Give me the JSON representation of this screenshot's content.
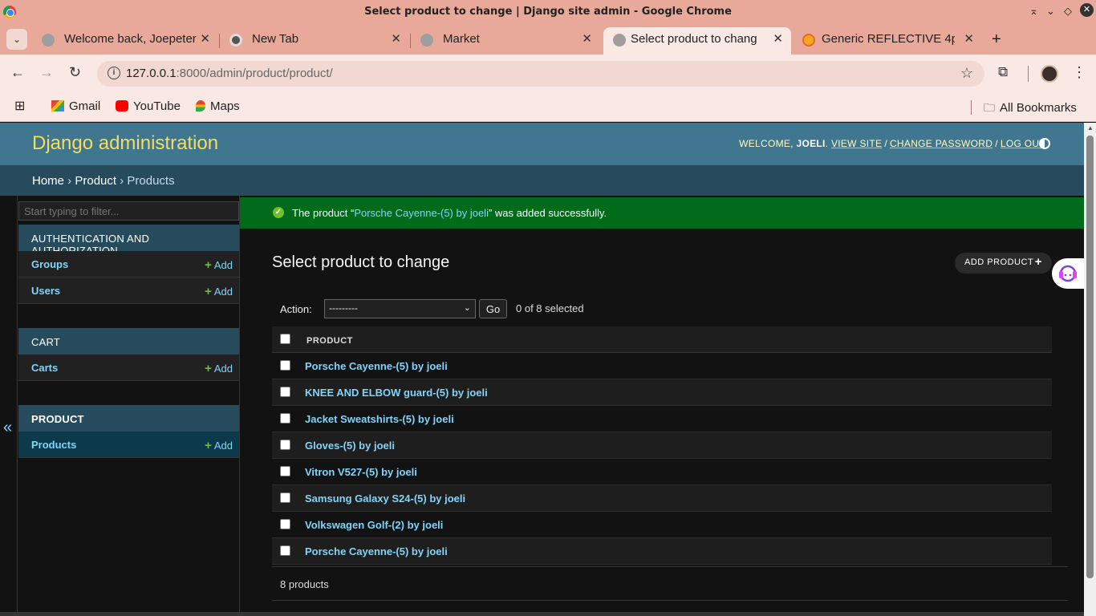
{
  "window": {
    "title": "Select product to change | Django site admin - Google Chrome",
    "controls": [
      "⌅",
      "⌄",
      "◇",
      "✕"
    ]
  },
  "tabs": [
    {
      "label": "Welcome back, Joepeter",
      "favicon": "globe-icon"
    },
    {
      "label": "New Tab",
      "favicon": "chrome-icon"
    },
    {
      "label": "Market",
      "favicon": "globe-icon"
    },
    {
      "label": "Select product to chang",
      "favicon": "globe-icon",
      "active": true
    },
    {
      "label": "Generic REFLECTIVE 4pc",
      "favicon": "aliexpress-icon"
    }
  ],
  "toolbar": {
    "url_host": "127.0.0.1",
    "url_path": ":8000/admin/product/product/"
  },
  "bookmarks": [
    {
      "label": "Gmail",
      "icon": "gmail-icon"
    },
    {
      "label": "YouTube",
      "icon": "youtube-icon"
    },
    {
      "label": "Maps",
      "icon": "maps-icon"
    }
  ],
  "bookmarks_all": "All Bookmarks",
  "django": {
    "site_name": "Django administration",
    "welcome": "WELCOME,",
    "username": "JOELI",
    "view_site": "VIEW SITE",
    "change_password": "CHANGE PASSWORD",
    "log_out": "LOG OUT",
    "breadcrumbs": [
      "Home",
      "Product",
      "Products"
    ],
    "filter_placeholder": "Start typing to filter...",
    "modules": [
      {
        "caption": "AUTHENTICATION AND AUTHORIZATION",
        "models": [
          {
            "name": "Groups",
            "add": "Add"
          },
          {
            "name": "Users",
            "add": "Add"
          }
        ]
      },
      {
        "caption": "CART",
        "models": [
          {
            "name": "Carts",
            "add": "Add"
          }
        ]
      },
      {
        "caption": "PRODUCT",
        "models": [
          {
            "name": "Products",
            "add": "Add"
          }
        ]
      }
    ],
    "message": {
      "prefix": "The product “",
      "link": "Porsche Cayenne-(5) by joeli",
      "suffix": "” was added successfully."
    },
    "page_title": "Select product to change",
    "add_button": "ADD PRODUCT",
    "action_label": "Action:",
    "action_selected": "---------",
    "go": "Go",
    "selection_count": "0 of 8 selected",
    "column_header": "PRODUCT",
    "rows": [
      "Porsche Cayenne-(5) by joeli",
      "KNEE AND ELBOW guard-(5) by joeli",
      "Jacket Sweatshirts-(5) by joeli",
      "Gloves-(5) by joeli",
      "Vitron V527-(5) by joeli",
      "Samsung Galaxy S24-(5) by joeli",
      "Volkswagen Golf-(2) by joeli",
      "Porsche Cayenne-(5) by joeli"
    ],
    "paginator": "8 products"
  },
  "colors": {
    "header": "#417690",
    "breadcrumbs": "#264b5d",
    "success": "#006b1b",
    "link": "#81d4fa",
    "brand": "#f5dd5d"
  }
}
